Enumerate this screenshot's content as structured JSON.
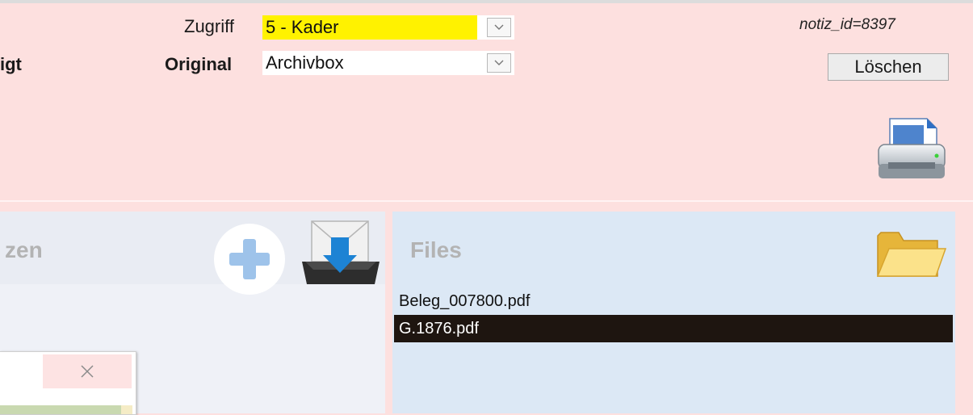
{
  "header": {
    "cut_label": "igt",
    "zugriff_label": "Zugriff",
    "zugriff_value": "5 - Kader",
    "original_label": "Original",
    "original_value": "Archivbox",
    "notiz_id": "notiz_id=8397",
    "delete_label": "Löschen"
  },
  "left_panel": {
    "title": "zen"
  },
  "files_panel": {
    "title": "Files",
    "items": [
      "Beleg_007800.pdf",
      "G.1876.pdf"
    ],
    "selected_index": 1
  },
  "colors": {
    "background": "#fde0df",
    "highlight_yellow": "#fff200",
    "left_panel": "#eff1f7",
    "files_panel": "#dce8f5",
    "selected_row": "#1e1510"
  },
  "icons": [
    "chevron-down-icon",
    "printer-icon",
    "plus-icon",
    "mail-download-icon",
    "folder-icon",
    "close-icon"
  ]
}
